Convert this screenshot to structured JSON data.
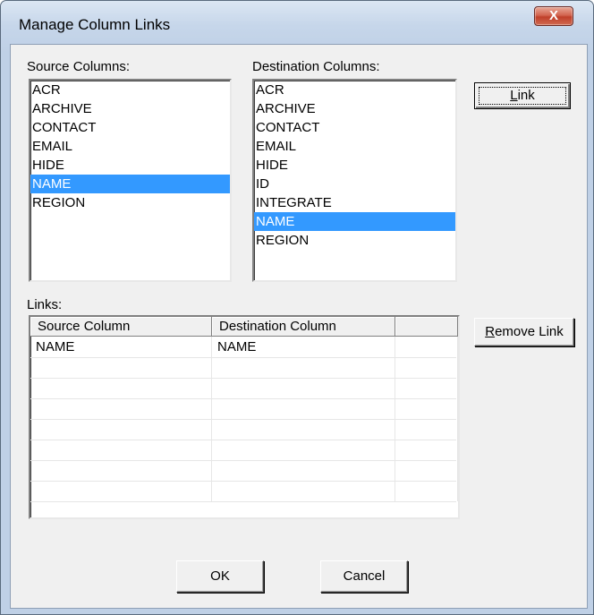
{
  "window": {
    "title": "Manage Column Links",
    "close_glyph": "X"
  },
  "source": {
    "label": "Source Columns:",
    "items": [
      "ACR",
      "ARCHIVE",
      "CONTACT",
      "EMAIL",
      "HIDE",
      "NAME",
      "REGION"
    ],
    "selected": "NAME"
  },
  "destination": {
    "label": "Destination Columns:",
    "items": [
      "ACR",
      "ARCHIVE",
      "CONTACT",
      "EMAIL",
      "HIDE",
      "ID",
      "INTEGRATE",
      "NAME",
      "REGION"
    ],
    "selected": "NAME"
  },
  "buttons": {
    "link": {
      "mnemonic": "L",
      "rest": "ink"
    },
    "remove_link": {
      "mnemonic": "R",
      "rest": "emove Link"
    },
    "ok": "OK",
    "cancel": "Cancel"
  },
  "links": {
    "label": "Links:",
    "headers": [
      "Source Column",
      "Destination Column",
      ""
    ],
    "rows": [
      [
        "NAME",
        "NAME",
        ""
      ]
    ]
  },
  "colors": {
    "selection": "#3399ff",
    "dialog_bg": "#f0f0f0",
    "close_button": "#c0402a"
  }
}
